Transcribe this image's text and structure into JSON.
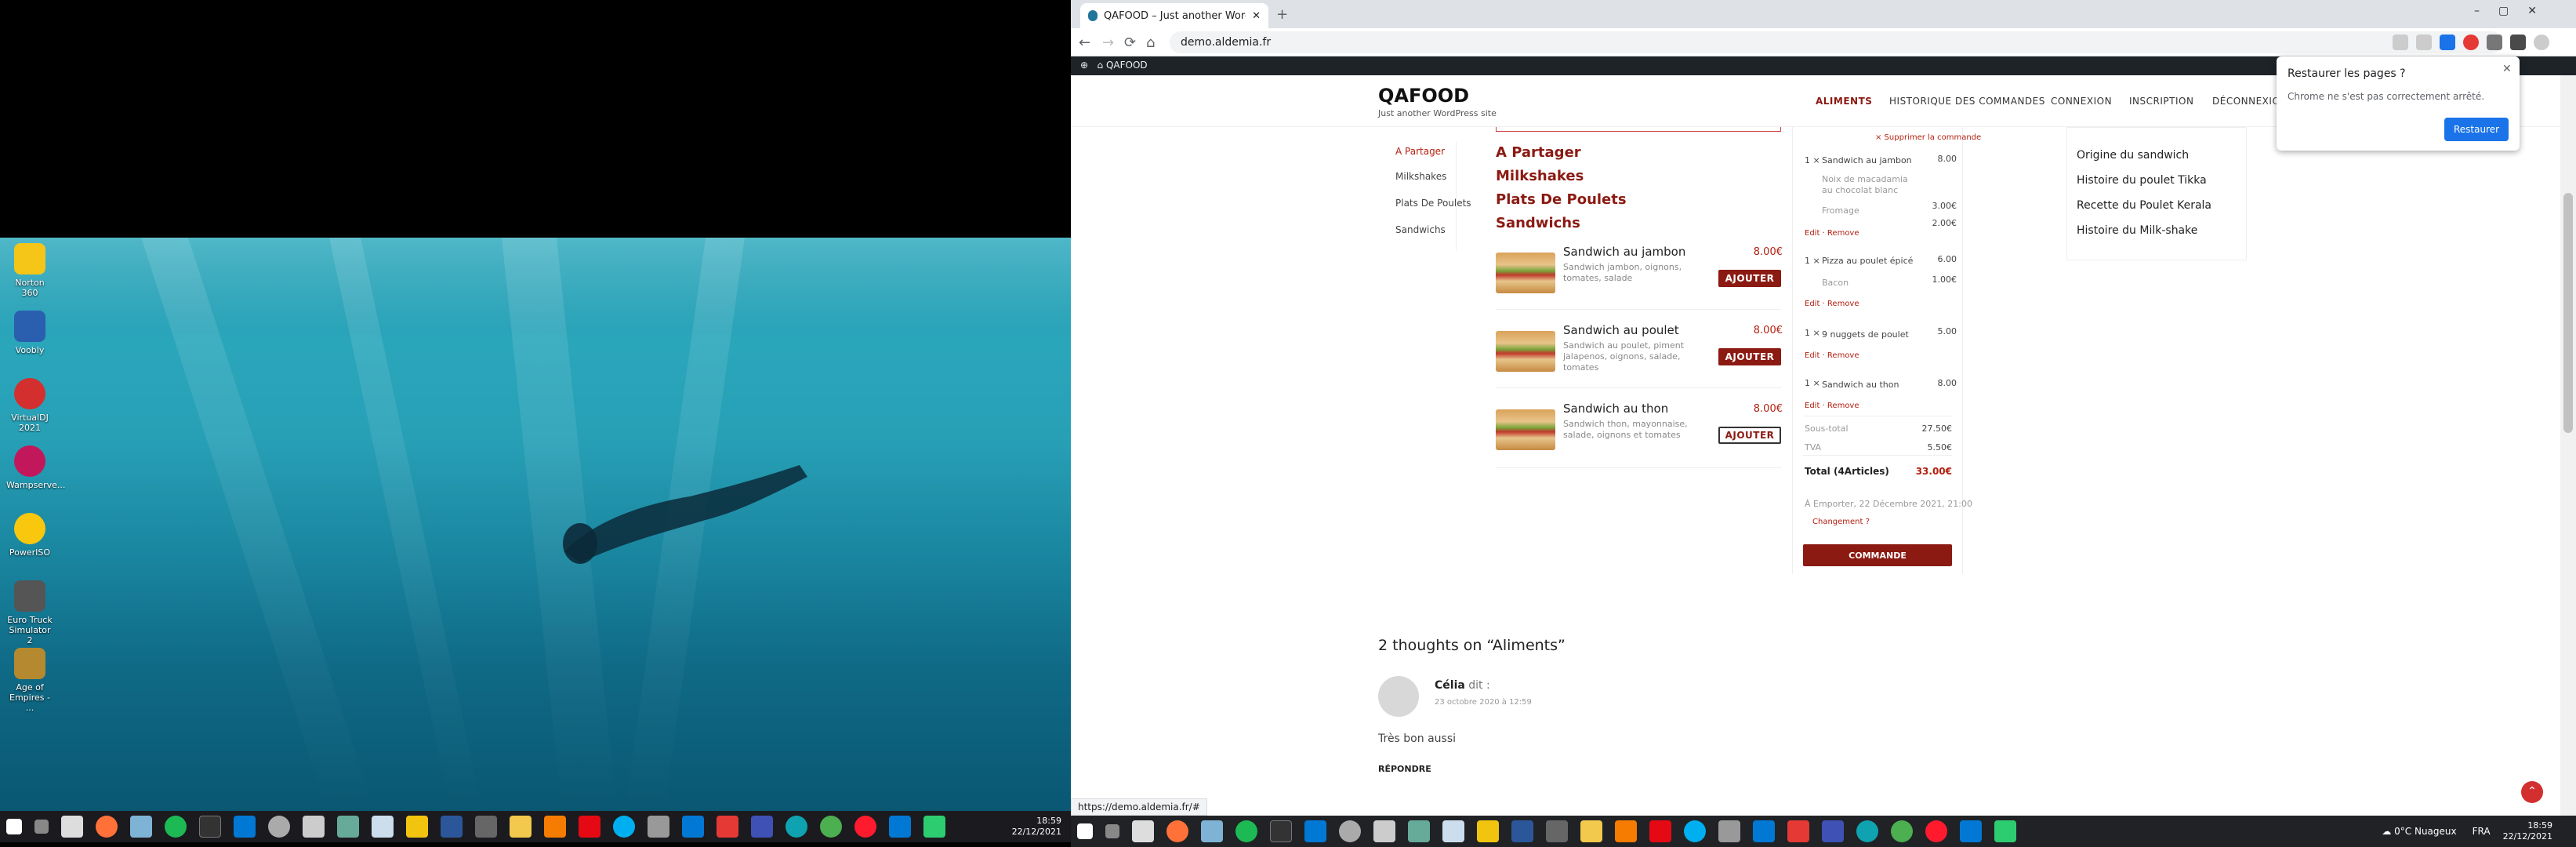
{
  "left_screen": {
    "desktop_icons": [
      {
        "label": "Norton 360",
        "icon": "norton-icon",
        "color": "#f5c518"
      },
      {
        "label": "Voobly",
        "icon": "voobly-icon",
        "color": "#2a5fb0"
      },
      {
        "label": "VirtualDJ 2021",
        "icon": "virtualdj-icon",
        "color": "#d32f2f"
      },
      {
        "label": "Wampserve...",
        "icon": "wampserver-icon",
        "color": "#c2185b"
      },
      {
        "label": "PowerISO",
        "icon": "poweriso-icon",
        "color": "#f9c80e"
      },
      {
        "label": "Euro Truck Simulator 2",
        "icon": "eurotruck-icon",
        "color": "#555"
      },
      {
        "label": "Age of Empires - ...",
        "icon": "ageofempires-icon",
        "color": "#b5892f"
      }
    ],
    "clock_time": "18:59",
    "clock_date": "22/12/2021"
  },
  "browser": {
    "tab_title": "QAFOOD – Just another WordPr...",
    "url": "demo.aldemia.fr",
    "wp_site": "QAFOOD",
    "status_url": "https://demo.aldemia.fr/#"
  },
  "site": {
    "logo": "QAFOOD",
    "tagline": "Just another WordPress site",
    "menu": [
      "ALIMENTS",
      "HISTORIQUE DES COMMANDES",
      "CONNEXION",
      "INSCRIPTION",
      "DÉCONNEXION"
    ],
    "categories": [
      "A Partager",
      "Milkshakes",
      "Plats De Poulets",
      "Sandwichs"
    ],
    "headings": [
      "A Partager",
      "Milkshakes",
      "Plats De Poulets",
      "Sandwichs"
    ],
    "products": [
      {
        "name": "Sandwich au jambon",
        "price": "8.00€",
        "desc": "Sandwich jambon, oignons, tomates, salade",
        "btn": "AJOUTER"
      },
      {
        "name": "Sandwich au poulet",
        "price": "8.00€",
        "desc": "Sandwich au poulet, piment jalapenos, oignons, salade, tomates",
        "btn": "AJOUTER"
      },
      {
        "name": "Sandwich au thon",
        "price": "8.00€",
        "desc": "Sandwich thon, mayonnaise, salade, oignons et tomates",
        "btn": "AJOUTER"
      }
    ],
    "cart": {
      "delete_link": "× Supprimer la commande",
      "items": [
        {
          "qty": "1 ×",
          "name": "Sandwich au jambon",
          "price": "8.00",
          "mods": [
            {
              "name": "Noix de macadamia au chocolat blanc",
              "price": ""
            },
            {
              "name": "Fromage",
              "price": "3.00€"
            },
            {
              "name": "",
              "price": "2.00€"
            }
          ]
        },
        {
          "qty": "1 ×",
          "name": "Pizza au poulet épicé",
          "price": "6.00",
          "mods": [
            {
              "name": "Bacon",
              "price": "1.00€"
            }
          ]
        },
        {
          "qty": "1 ×",
          "name": "9 nuggets de poulet",
          "price": "5.00",
          "mods": []
        },
        {
          "qty": "1 ×",
          "name": "Sandwich au thon",
          "price": "8.00",
          "mods": []
        }
      ],
      "edit": "Edit",
      "remove": "Remove",
      "subtotal_label": "Sous-total",
      "subtotal": "27.50€",
      "tva_label": "TVA",
      "tva": "5.50€",
      "total_label": "Total (4Articles)",
      "total": "33.00€",
      "delivery": "À Emporter, 22 Décembre 2021, 21:00",
      "change": "Changement ?",
      "order_btn": "COMMANDE"
    },
    "sidebar_links": [
      "Origine du sandwich",
      "Histoire du poulet Tikka",
      "Recette du Poulet Kerala",
      "Histoire du Milk-shake"
    ],
    "comments_title": "2 thoughts on “Aliments”",
    "comment": {
      "author": "Célia",
      "says": "dit :",
      "date": "23 octobre 2020 à 12:59",
      "text": "Très bon aussi",
      "reply": "RÉPONDRE"
    }
  },
  "popup": {
    "title": "Restaurer les pages ?",
    "text": "Chrome ne s'est pas correctement arrêté.",
    "button": "Restaurer"
  },
  "right_taskbar": {
    "weather": "0°C  Nuageux",
    "lang": "FRA",
    "time": "18:59",
    "date": "22/12/2021"
  }
}
